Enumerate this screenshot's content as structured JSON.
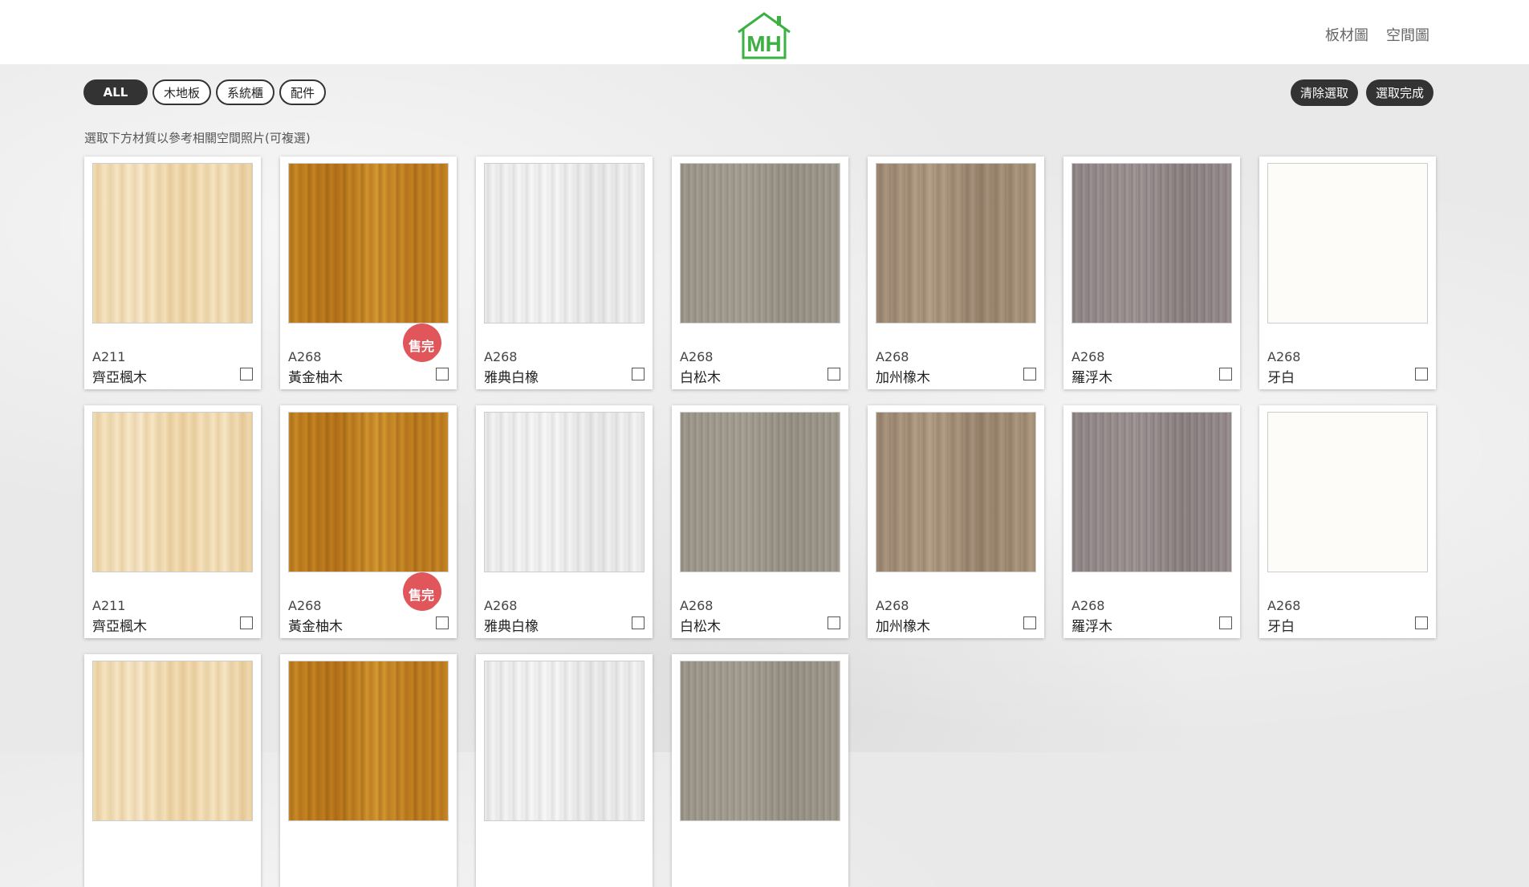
{
  "nav": {
    "board": "板材圖",
    "space": "空間圖"
  },
  "filters": [
    "ALL",
    "木地板",
    "系統櫃",
    "配件"
  ],
  "actions": {
    "clear": "清除選取",
    "done": "選取完成"
  },
  "instruction": "選取下方材質以參考相關空間照片(可複選)",
  "sold_badge": "售完",
  "products": [
    {
      "code": "A211",
      "name": "齊亞楓木",
      "texture": "maple",
      "sold_out": false
    },
    {
      "code": "A268",
      "name": "黃金柚木",
      "texture": "teak",
      "sold_out": true
    },
    {
      "code": "A268",
      "name": "雅典白橡",
      "texture": "whiteoak",
      "sold_out": false
    },
    {
      "code": "A268",
      "name": "白松木",
      "texture": "pine",
      "sold_out": false
    },
    {
      "code": "A268",
      "name": "加州橡木",
      "texture": "caloak",
      "sold_out": false
    },
    {
      "code": "A268",
      "name": "羅浮木",
      "texture": "rome",
      "sold_out": false
    },
    {
      "code": "A268",
      "name": "牙白",
      "texture": "ivory",
      "sold_out": false
    },
    {
      "code": "A211",
      "name": "齊亞楓木",
      "texture": "maple",
      "sold_out": false
    },
    {
      "code": "A268",
      "name": "黃金柚木",
      "texture": "teak",
      "sold_out": true
    },
    {
      "code": "A268",
      "name": "雅典白橡",
      "texture": "whiteoak",
      "sold_out": false
    },
    {
      "code": "A268",
      "name": "白松木",
      "texture": "pine",
      "sold_out": false
    },
    {
      "code": "A268",
      "name": "加州橡木",
      "texture": "caloak",
      "sold_out": false
    },
    {
      "code": "A268",
      "name": "羅浮木",
      "texture": "rome",
      "sold_out": false
    },
    {
      "code": "A268",
      "name": "牙白",
      "texture": "ivory",
      "sold_out": false
    },
    {
      "code": "",
      "name": "",
      "texture": "maple",
      "sold_out": false
    },
    {
      "code": "",
      "name": "",
      "texture": "teak",
      "sold_out": false
    },
    {
      "code": "",
      "name": "",
      "texture": "whiteoak",
      "sold_out": false
    },
    {
      "code": "",
      "name": "",
      "texture": "pine",
      "sold_out": false
    }
  ],
  "colors": {
    "brand_green": "#3cb043",
    "sold_red": "#e0565b",
    "button_dark": "#333333"
  }
}
